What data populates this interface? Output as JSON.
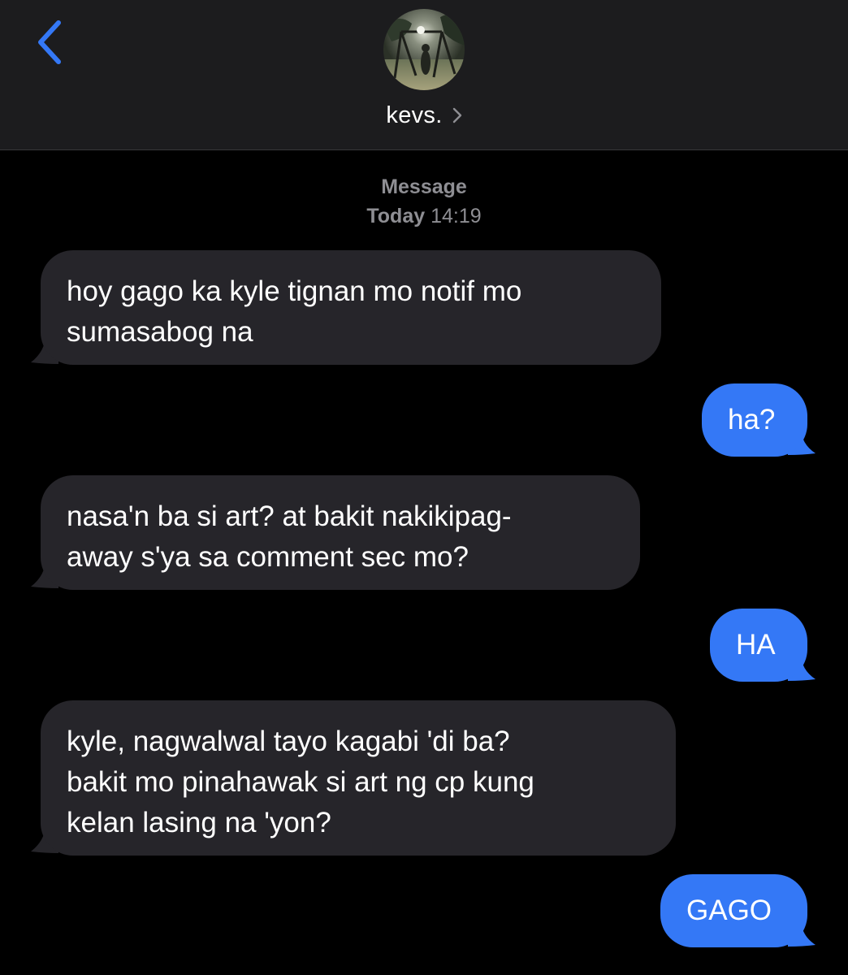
{
  "header": {
    "contact_name": "kevs.",
    "back_icon": "chevron-left-icon",
    "accent_color": "#3478f6"
  },
  "meta": {
    "service": "Message",
    "day": "Today",
    "time": "14:19"
  },
  "messages": [
    {
      "direction": "incoming",
      "lines": [
        "hoy gago ka kyle tignan mo notif mo",
        "sumasabog na"
      ]
    },
    {
      "direction": "outgoing",
      "lines": [
        "ha?"
      ]
    },
    {
      "direction": "incoming",
      "lines": [
        "nasa'n ba si art? at bakit nakikipag-",
        "away s'ya sa comment sec mo?"
      ]
    },
    {
      "direction": "outgoing",
      "lines": [
        "HA"
      ]
    },
    {
      "direction": "incoming",
      "lines": [
        "kyle, nagwalwal tayo kagabi 'di ba?",
        "bakit mo pinahawak si art ng cp kung",
        "kelan lasing na 'yon?"
      ]
    },
    {
      "direction": "outgoing",
      "lines": [
        "GAGO"
      ]
    }
  ],
  "colors": {
    "incoming_bubble": "#26252a",
    "outgoing_bubble": "#3478f6",
    "header_bg": "#1c1c1e",
    "meta_text": "#8e8e93"
  }
}
